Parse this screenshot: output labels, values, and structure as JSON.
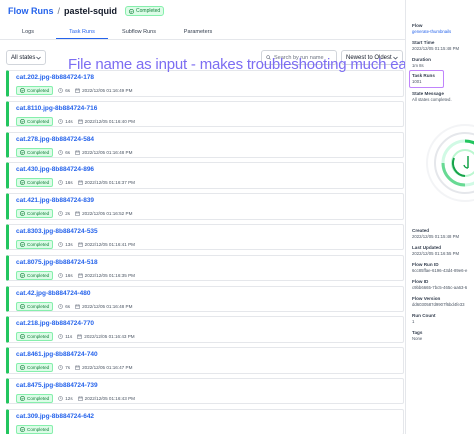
{
  "header": {
    "breadcrumb_parent": "Flow Runs",
    "separator": "/",
    "run_name": "pastel-squid",
    "state_badge": "Completed"
  },
  "tabs": [
    {
      "label": "Logs",
      "active": false
    },
    {
      "label": "Task Runs",
      "active": true
    },
    {
      "label": "Subflow Runs",
      "active": false
    },
    {
      "label": "Parameters",
      "active": false
    }
  ],
  "filters": {
    "state_filter": "All states",
    "search_placeholder": "Search by run name",
    "sort": "Newest to Oldest"
  },
  "annotation": "File name as input - makes troubleshooting much easier",
  "task_runs": [
    {
      "name": "cat.202.jpg-8b884724-178",
      "state": "Completed",
      "duration": "6s",
      "timestamp": "2022/12/05 01:16:49 PM"
    },
    {
      "name": "cat.8110.jpg-8b884724-716",
      "state": "Completed",
      "duration": "14s",
      "timestamp": "2022/12/05 01:16:40 PM"
    },
    {
      "name": "cat.278.jpg-8b884724-584",
      "state": "Completed",
      "duration": "6s",
      "timestamp": "2022/12/05 01:16:48 PM"
    },
    {
      "name": "cat.430.jpg-8b884724-896",
      "state": "Completed",
      "duration": "16s",
      "timestamp": "2022/12/05 01:16:37 PM"
    },
    {
      "name": "cat.421.jpg-8b884724-839",
      "state": "Completed",
      "duration": "2s",
      "timestamp": "2022/12/05 01:16:52 PM"
    },
    {
      "name": "cat.8303.jpg-8b884724-535",
      "state": "Completed",
      "duration": "13s",
      "timestamp": "2022/12/05 01:16:41 PM"
    },
    {
      "name": "cat.8075.jpg-8b884724-518",
      "state": "Completed",
      "duration": "16s",
      "timestamp": "2022/12/05 01:16:35 PM"
    },
    {
      "name": "cat.42.jpg-8b884724-480",
      "state": "Completed",
      "duration": "6s",
      "timestamp": "2022/12/05 01:16:48 PM"
    },
    {
      "name": "cat.218.jpg-8b884724-770",
      "state": "Completed",
      "duration": "11s",
      "timestamp": "2022/12/05 01:16:43 PM"
    },
    {
      "name": "cat.8461.jpg-8b884724-740",
      "state": "Completed",
      "duration": "7s",
      "timestamp": "2022/12/05 01:16:47 PM"
    },
    {
      "name": "cat.8475.jpg-8b884724-739",
      "state": "Completed",
      "duration": "12s",
      "timestamp": "2022/12/05 01:16:43 PM"
    },
    {
      "name": "cat.309.jpg-8b884724-642",
      "state": "Completed",
      "duration": "",
      "timestamp": ""
    }
  ],
  "sidebar": {
    "flow_label": "Flow",
    "flow_value": "generate-thumbnails",
    "start_time_label": "Start Time",
    "start_time_value": "2022/12/05 01:15:48 PM",
    "duration_label": "Duration",
    "duration_value": "1m 8s",
    "task_runs_label": "Task Runs",
    "task_runs_value": "1001",
    "state_message_label": "State Message",
    "state_message_value": "All states completed.",
    "created_label": "Created",
    "created_value": "2022/12/05 01:15:48 PM",
    "last_updated_label": "Last Updated",
    "last_updated_value": "2022/12/05 01:16:55 PM",
    "flow_run_id_label": "Flow Run ID",
    "flow_run_id_value": "6cc85ffae-6196-43d4-89e6-e",
    "flow_id_label": "Flow ID",
    "flow_id_value": "c9bb6665-7bc5-465c-aa63-6",
    "flow_version_label": "Flow Version",
    "flow_version_value": "dd6030587d9907f6bd4fe33",
    "run_count_label": "Run Count",
    "run_count_value": "1",
    "tags_label": "Tags",
    "tags_value": "None"
  },
  "colors": {
    "accent": "#2563eb",
    "success": "#22c55e",
    "annotation": "#7c6df2",
    "highlight": "#c084fc"
  }
}
